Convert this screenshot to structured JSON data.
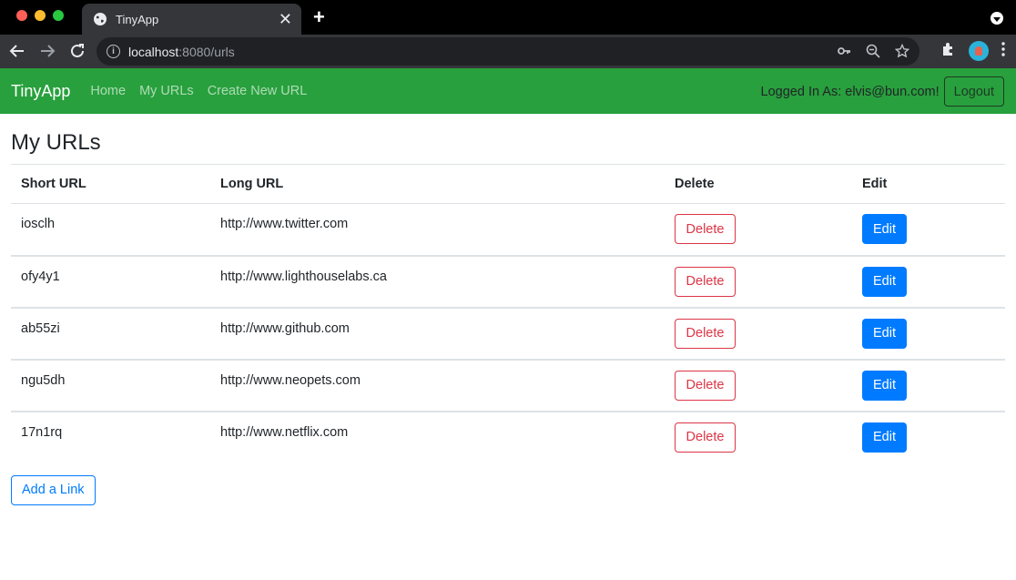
{
  "browser": {
    "tab_title": "TinyApp",
    "url_host": "localhost",
    "url_rest": ":8080/urls"
  },
  "app": {
    "brand": "TinyApp",
    "nav": [
      "Home",
      "My URLs",
      "Create New URL"
    ],
    "logged_in_text": "Logged In As: elvis@bun.com!",
    "logout_label": "Logout",
    "accent_color": "#28a03d"
  },
  "main": {
    "title": "My URLs",
    "columns": [
      "Short URL",
      "Long URL",
      "Delete",
      "Edit"
    ],
    "rows": [
      {
        "short": "iosclh",
        "long": "http://www.twitter.com",
        "delete": "Delete",
        "edit": "Edit"
      },
      {
        "short": "ofy4y1",
        "long": "http://www.lighthouselabs.ca",
        "delete": "Delete",
        "edit": "Edit"
      },
      {
        "short": "ab55zi",
        "long": "http://www.github.com",
        "delete": "Delete",
        "edit": "Edit"
      },
      {
        "short": "ngu5dh",
        "long": "http://www.neopets.com",
        "delete": "Delete",
        "edit": "Edit"
      },
      {
        "short": "17n1rq",
        "long": "http://www.netflix.com",
        "delete": "Delete",
        "edit": "Edit"
      }
    ],
    "add_label": "Add a Link"
  },
  "icons": {
    "tab": "globe-icon",
    "toolbar": [
      "back-arrow-icon",
      "forward-arrow-icon",
      "reload-icon",
      "info-icon",
      "key-icon",
      "zoom-icon",
      "star-icon",
      "extensions-icon",
      "profile-avatar",
      "menu-kebab-icon"
    ]
  }
}
